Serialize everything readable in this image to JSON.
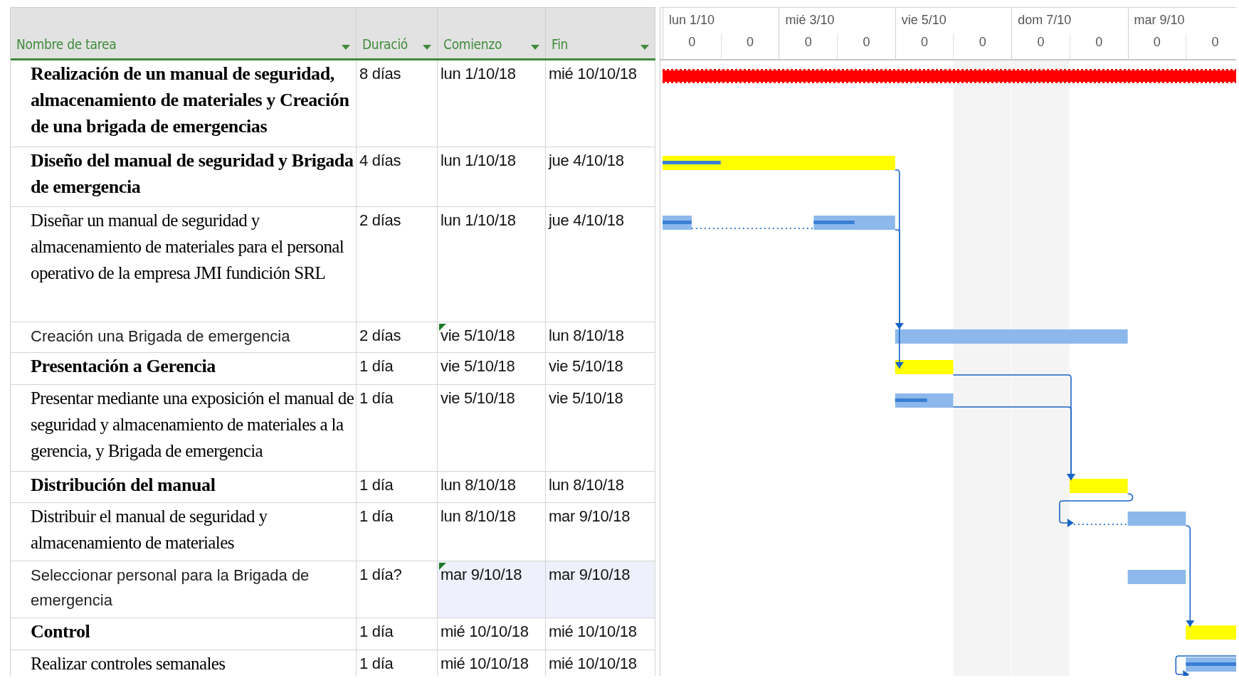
{
  "table": {
    "columns": [
      {
        "label": "Nombre de tarea"
      },
      {
        "label": "Duració"
      },
      {
        "label": "Comienzo"
      },
      {
        "label": "Fin"
      }
    ],
    "rows": [
      {
        "kind": "summary",
        "name": "Realización de un manual de seguridad, almacenamiento de materiales y Creación de una brigada de emergencias",
        "duration": "8 días",
        "start": "lun 1/10/18",
        "end": "mié 10/10/18",
        "selected": false,
        "start_flag": false,
        "bar": {
          "kind": "project"
        }
      },
      {
        "kind": "summary",
        "name": "Diseño del manual de seguridad y Brigada de emergencia",
        "duration": "4 días",
        "start": "lun 1/10/18",
        "end": "jue 4/10/18",
        "selected": false,
        "start_flag": false,
        "bar": {
          "kind": "summary"
        }
      },
      {
        "kind": "task",
        "name": "Diseñar un manual de seguridad y almacenamiento de materiales para el personal operativo de la empresa JMI fundición SRL",
        "duration": "2 días",
        "start": "lun 1/10/18",
        "end": "jue 4/10/18",
        "selected": false,
        "start_flag": false,
        "bar": {
          "kind": "split"
        }
      },
      {
        "kind": "plain",
        "name": "Creación una Brigada de emergencia",
        "duration": "2 días",
        "start": "vie 5/10/18",
        "end": "lun 8/10/18",
        "selected": false,
        "start_flag": true,
        "bar": {
          "kind": "task"
        }
      },
      {
        "kind": "summary",
        "name": "Presentación a Gerencia",
        "duration": "1 día",
        "start": "vie 5/10/18",
        "end": "vie 5/10/18",
        "selected": false,
        "start_flag": false,
        "bar": {
          "kind": "summary"
        }
      },
      {
        "kind": "task",
        "name": "Presentar mediante una exposición el manual de seguridad y almacenamiento de materiales a la gerencia, y Brigada de emergencia",
        "duration": "1 día",
        "start": "vie 5/10/18",
        "end": "vie 5/10/18",
        "selected": false,
        "start_flag": false,
        "bar": {
          "kind": "task"
        }
      },
      {
        "kind": "summary",
        "name": "Distribución del manual",
        "duration": "1 día",
        "start": "lun 8/10/18",
        "end": "lun 8/10/18",
        "selected": false,
        "start_flag": false,
        "bar": {
          "kind": "summary"
        }
      },
      {
        "kind": "task",
        "name": "Distribuir el manual de seguridad y almacenamiento de materiales",
        "duration": "1 día",
        "start": "lun 8/10/18",
        "end": "mar 9/10/18",
        "selected": false,
        "start_flag": false,
        "bar": {
          "kind": "split"
        }
      },
      {
        "kind": "plain",
        "name": "Seleccionar personal para la Brigada de emergencia",
        "duration": "1 día?",
        "start": "mar 9/10/18",
        "end": "mar 9/10/18",
        "selected": true,
        "start_flag": true,
        "bar": {
          "kind": "task"
        }
      },
      {
        "kind": "summary",
        "name": "Control",
        "duration": "1 día",
        "start": "mié 10/10/18",
        "end": "mié 10/10/18",
        "selected": false,
        "start_flag": false,
        "bar": {
          "kind": "summary"
        }
      },
      {
        "kind": "task",
        "name": "Realizar controles semanales",
        "duration": "1 día",
        "start": "mié 10/10/18",
        "end": "mié 10/10/18",
        "selected": false,
        "start_flag": false,
        "bar": {
          "kind": "task"
        }
      }
    ]
  },
  "timeline": {
    "days": [
      "lun 1/10",
      "mié 3/10",
      "vie 5/10",
      "dom 7/10",
      "mar 9/10"
    ],
    "units": [
      "0",
      "0",
      "0",
      "0",
      "0",
      "0",
      "0",
      "0",
      "0",
      "0"
    ]
  }
}
